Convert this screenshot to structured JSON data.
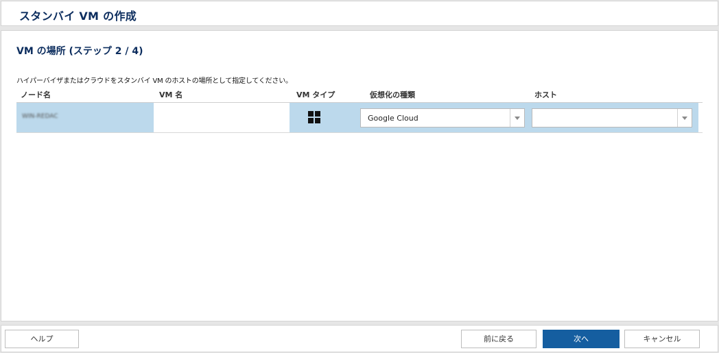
{
  "window": {
    "title": "スタンバイ VM の作成"
  },
  "step": {
    "title": "VM の場所 (ステップ 2 / 4)",
    "instruction": "ハイパーバイザまたはクラウドをスタンバイ VM のホストの場所として指定してください。"
  },
  "grid": {
    "columns": [
      "ノード名",
      "VM 名",
      "VM タイプ",
      "仮想化の種類",
      "ホスト"
    ],
    "rows": [
      {
        "node_name": "WIN-REDAC",
        "vm_name": "",
        "vm_type_icon": "windows-icon",
        "virtualization_type": "Google Cloud",
        "host": ""
      }
    ]
  },
  "footer": {
    "help_label": "ヘルプ",
    "back_label": "前に戻る",
    "next_label": "次へ",
    "cancel_label": "キャンセル"
  },
  "colors": {
    "title_text": "#0c2d5e",
    "selected_row": "#bcd9ec",
    "primary_button": "#155ea0"
  }
}
